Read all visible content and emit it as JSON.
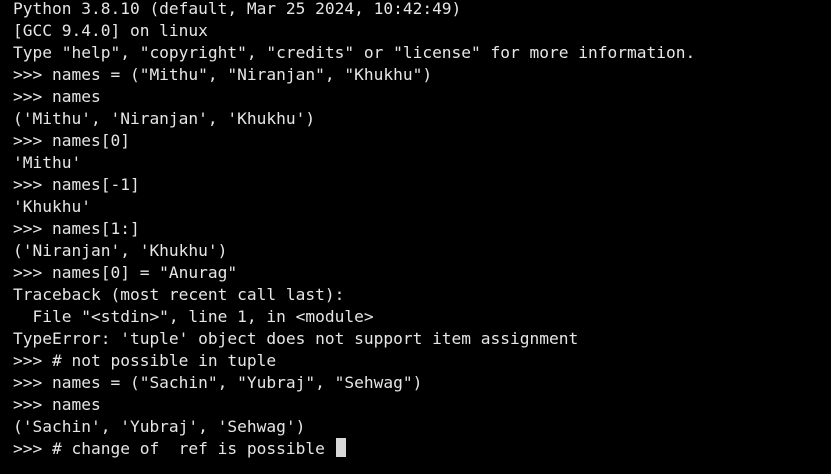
{
  "terminal": {
    "lines": [
      "Python 3.8.10 (default, Mar 25 2024, 10:42:49)",
      "[GCC 9.4.0] on linux",
      "Type \"help\", \"copyright\", \"credits\" or \"license\" for more information.",
      ">>> names = (\"Mithu\", \"Niranjan\", \"Khukhu\")",
      ">>> names",
      "('Mithu', 'Niranjan', 'Khukhu')",
      ">>> names[0]",
      "'Mithu'",
      ">>> names[-1]",
      "'Khukhu'",
      ">>> names[1:]",
      "('Niranjan', 'Khukhu')",
      ">>> names[0] = \"Anurag\"",
      "Traceback (most recent call last):",
      "  File \"<stdin>\", line 1, in <module>",
      "TypeError: 'tuple' object does not support item assignment",
      ">>> # not possible in tuple",
      ">>> names = (\"Sachin\", \"Yubraj\", \"Sehwag\")",
      ">>> names",
      "('Sachin', 'Yubraj', 'Sehwag')",
      ">>> # change of  ref is possible "
    ],
    "colors": {
      "background": "#000000",
      "text": "#e6e6e6",
      "cursor": "#d8d8d8"
    }
  }
}
